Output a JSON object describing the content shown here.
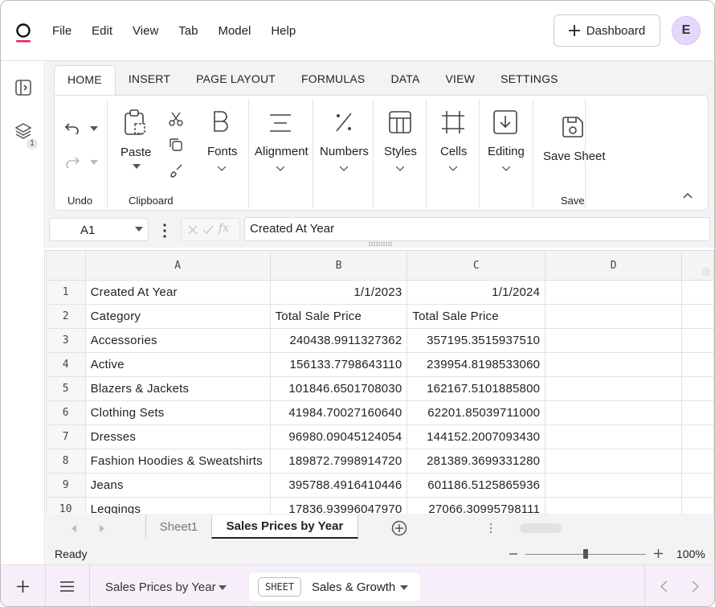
{
  "menu": {
    "items": [
      "File",
      "Edit",
      "View",
      "Tab",
      "Model",
      "Help"
    ]
  },
  "header": {
    "dashboard_label": "Dashboard",
    "avatar_initial": "E"
  },
  "rail": {
    "layers_badge": "1"
  },
  "ribbon": {
    "tabs": [
      "HOME",
      "INSERT",
      "PAGE LAYOUT",
      "FORMULAS",
      "DATA",
      "VIEW",
      "SETTINGS"
    ],
    "active_tab": "HOME",
    "groups": {
      "undo": "Undo",
      "clipboard": "Clipboard",
      "save": "Save"
    },
    "buttons": {
      "paste": "Paste",
      "fonts": "Fonts",
      "alignment": "Alignment",
      "numbers": "Numbers",
      "styles": "Styles",
      "cells": "Cells",
      "editing": "Editing",
      "save_sheet": "Save Sheet"
    }
  },
  "formula_bar": {
    "cell_ref": "A1",
    "fx": "fx",
    "content": "Created At Year"
  },
  "grid": {
    "columns": [
      "A",
      "B",
      "C",
      "D"
    ],
    "rows": [
      {
        "n": "1",
        "a": "Created At Year",
        "b": "1/1/2023",
        "c": "1/1/2024"
      },
      {
        "n": "2",
        "a": "Category",
        "b": "Total Sale Price",
        "c": "Total Sale Price"
      },
      {
        "n": "3",
        "a": "Accessories",
        "b": "240438.9911327362",
        "c": "357195.3515937510"
      },
      {
        "n": "4",
        "a": "Active",
        "b": "156133.7798643110",
        "c": "239954.8198533060"
      },
      {
        "n": "5",
        "a": "Blazers & Jackets",
        "b": "101846.6501708030",
        "c": "162167.5101885800"
      },
      {
        "n": "6",
        "a": "Clothing Sets",
        "b": "41984.70027160640",
        "c": "62201.85039711000"
      },
      {
        "n": "7",
        "a": "Dresses",
        "b": "96980.09045124054",
        "c": "144152.2007093430"
      },
      {
        "n": "8",
        "a": "Fashion Hoodies & Sweatshirts",
        "b": "189872.7998914720",
        "c": "281389.3699331280"
      },
      {
        "n": "9",
        "a": "Jeans",
        "b": "395788.4916410446",
        "c": "601186.5125865936"
      },
      {
        "n": "10",
        "a": "Leggings",
        "b": "17836.93996047970",
        "c": "27066.30995798111"
      }
    ]
  },
  "sheet_tabs": [
    "Sheet1",
    "Sales Prices by Year"
  ],
  "status": {
    "state": "Ready",
    "zoom": "100%"
  },
  "bottom": {
    "workbook": "Sales Prices by Year",
    "chip_tag": "SHEET",
    "chip_name": "Sales & Growth"
  }
}
